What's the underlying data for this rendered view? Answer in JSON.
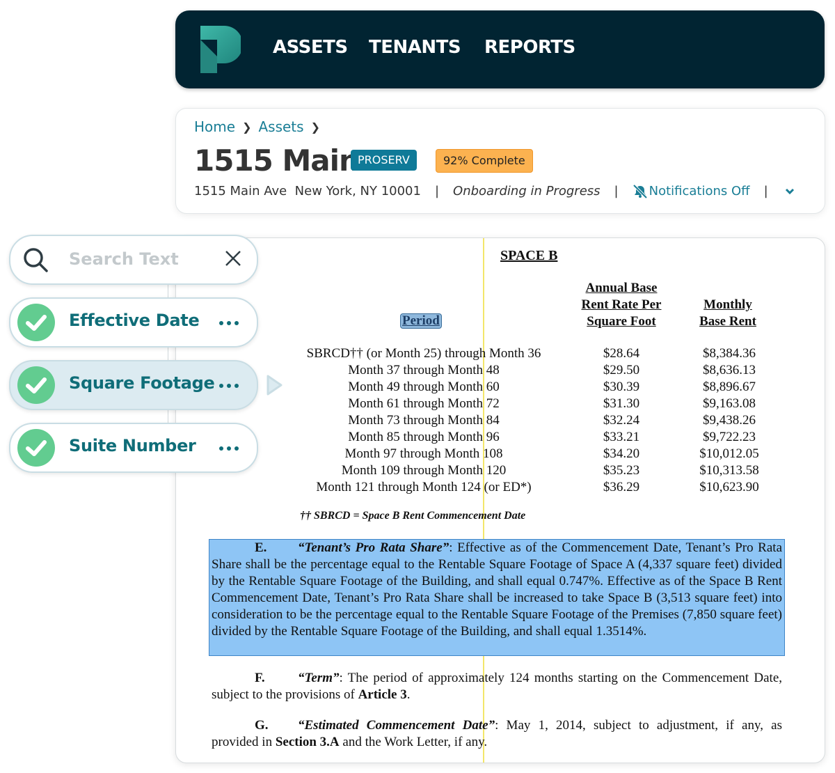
{
  "nav": {
    "items": [
      {
        "label": "ASSETS"
      },
      {
        "label": "TENANTS"
      },
      {
        "label": "REPORTS"
      }
    ]
  },
  "breadcrumb": {
    "items": [
      "Home",
      "Assets"
    ]
  },
  "asset": {
    "title": "1515 Main",
    "badge": "PROSERV",
    "progress_label": "92% Complete",
    "progress_percent": 92,
    "address": "1515 Main Ave  New York, NY 10001",
    "status": "Onboarding in Progress",
    "notifications": "Notifications Off",
    "separator": "|"
  },
  "sidebar": {
    "search_placeholder": "Search Text",
    "search_value": "",
    "fields": [
      {
        "label": "Effective Date",
        "done": true,
        "active": false
      },
      {
        "label": "Square Footage",
        "done": true,
        "active": true
      },
      {
        "label": "Suite Number",
        "done": true,
        "active": false
      }
    ]
  },
  "document": {
    "heading": "SPACE B",
    "columns": {
      "period": "Period",
      "rate": "Annual Base\nRent Rate Per\nSquare Foot",
      "rent": "Monthly\nBase Rent"
    },
    "rows": [
      {
        "period": "SBRCD†† (or Month 25) through Month 36",
        "rate": "$28.64",
        "rent": "$8,384.36"
      },
      {
        "period": "Month 37 through Month 48",
        "rate": "$29.50",
        "rent": "$8,636.13"
      },
      {
        "period": "Month 49 through Month 60",
        "rate": "$30.39",
        "rent": "$8,896.67"
      },
      {
        "period": "Month 61 through Month 72",
        "rate": "$31.30",
        "rent": "$9,163.08"
      },
      {
        "period": "Month 73 through Month 84",
        "rate": "$32.24",
        "rent": "$9,438.26"
      },
      {
        "period": "Month 85 through Month 96",
        "rate": "$33.21",
        "rent": "$9,722.23"
      },
      {
        "period": "Month 97 through Month 108",
        "rate": "$34.20",
        "rent": "$10,012.05"
      },
      {
        "period": "Month 109 through Month 120",
        "rate": "$35.23",
        "rent": "$10,313.58"
      },
      {
        "period": "Month 121 through Month 124 (or ED*)",
        "rate": "$36.29",
        "rent": "$10,623.90"
      }
    ],
    "footnote": "††  SBRCD = Space B Rent Commencement Date",
    "paragraphs": {
      "e": {
        "label": "E.",
        "term": "“Tenant’s Pro Rata Share”",
        "text": ":  Effective as of the Commencement Date, Tenant’s Pro Rata Share shall be the percentage equal to the Rentable Square Footage of Space A (4,337 square feet) divided by the Rentable Square Footage of the Building, and shall equal 0.747%. Effective as of the Space B Rent Commencement Date, Tenant’s Pro Rata Share shall be increased to take Space B (3,513 square feet) into consideration to be the percentage equal to the Rentable Square Footage of the Premises (7,850 square feet) divided by the Rentable Square Footage of the Building, and shall equal 1.3514%."
      },
      "f": {
        "label": "F.",
        "term": "“Term”",
        "text": ":   The period of approximately 124 months starting on the Commencement Date, subject to the provisions of ",
        "ref": "Article 3",
        "end": "."
      },
      "g": {
        "label": "G.",
        "term": "“Estimated Commencement Date”",
        "text": ":  May 1, 2014, subject to adjustment, if any, as provided in ",
        "ref": "Section 3.A",
        "end": " and the Work Letter, if any."
      }
    }
  }
}
